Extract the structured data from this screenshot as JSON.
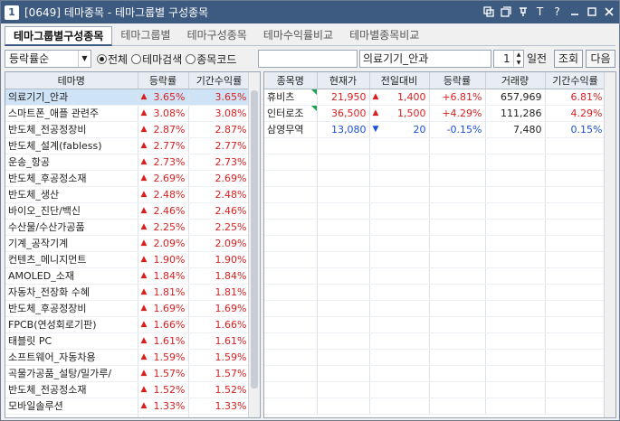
{
  "window": {
    "code": "[0649]",
    "title": "테마종목 - 테마그룹별 구성종목",
    "icon_num": "1"
  },
  "tabs": [
    "테마그룹별구성종목",
    "테마그룹별",
    "테마구성종목",
    "테마수익률비교",
    "테마별종목비교"
  ],
  "toolbar": {
    "sort_select": "등락률순",
    "radios": [
      {
        "label": "전체",
        "checked": true
      },
      {
        "label": "테마검색",
        "checked": false
      },
      {
        "label": "종목코드",
        "checked": false
      }
    ],
    "theme_input": "의료기기_안과",
    "days": "1",
    "days_label": "일전",
    "query_btn": "조회",
    "next_btn": "다음"
  },
  "left_table": {
    "headers": [
      "테마명",
      "등락률",
      "기간수익률"
    ],
    "rows": [
      {
        "name": "의료기기_안과",
        "rate": "3.65%",
        "period": "3.65%"
      },
      {
        "name": "스마트폰_애플 관련주",
        "rate": "3.08%",
        "period": "3.08%"
      },
      {
        "name": "반도체_전공정장비",
        "rate": "2.87%",
        "period": "2.87%"
      },
      {
        "name": "반도체_설계(fabless)",
        "rate": "2.77%",
        "period": "2.77%"
      },
      {
        "name": "운송_항공",
        "rate": "2.73%",
        "period": "2.73%"
      },
      {
        "name": "반도체_후공정소재",
        "rate": "2.69%",
        "period": "2.69%"
      },
      {
        "name": "반도체_생산",
        "rate": "2.48%",
        "period": "2.48%"
      },
      {
        "name": "바이오_진단/백신",
        "rate": "2.46%",
        "period": "2.46%"
      },
      {
        "name": "수산물/수산가공품",
        "rate": "2.25%",
        "period": "2.25%"
      },
      {
        "name": "기계_공작기계",
        "rate": "2.09%",
        "period": "2.09%"
      },
      {
        "name": "컨텐츠_메니지먼트",
        "rate": "1.90%",
        "period": "1.90%"
      },
      {
        "name": "AMOLED_소재",
        "rate": "1.84%",
        "period": "1.84%"
      },
      {
        "name": "자동차_전장화 수혜",
        "rate": "1.81%",
        "period": "1.81%"
      },
      {
        "name": "반도체_후공정장비",
        "rate": "1.69%",
        "period": "1.69%"
      },
      {
        "name": "FPCB(연성회로기판)",
        "rate": "1.66%",
        "period": "1.66%"
      },
      {
        "name": "태블릿 PC",
        "rate": "1.61%",
        "period": "1.61%"
      },
      {
        "name": "소프트웨어_자동차용",
        "rate": "1.59%",
        "period": "1.59%"
      },
      {
        "name": "곡물가공품_설탕/밀가루/",
        "rate": "1.57%",
        "period": "1.57%"
      },
      {
        "name": "반도체_전공정소재",
        "rate": "1.52%",
        "period": "1.52%"
      },
      {
        "name": "모바일솔루션",
        "rate": "1.33%",
        "period": "1.33%"
      }
    ]
  },
  "right_table": {
    "headers": [
      "종목명",
      "현재가",
      "전일대비",
      "등락률",
      "거래량",
      "기간수익률"
    ],
    "rows": [
      {
        "name": "휴비츠",
        "price": "21,950",
        "dir": "up",
        "change": "1,400",
        "rate": "+6.81%",
        "volume": "657,969",
        "period": "6.81%"
      },
      {
        "name": "인터로조",
        "price": "36,500",
        "dir": "up",
        "change": "1,500",
        "rate": "+4.29%",
        "volume": "111,286",
        "period": "4.29%"
      },
      {
        "name": "삼영무역",
        "price": "13,080",
        "dir": "down",
        "change": "20",
        "rate": "-0.15%",
        "volume": "7,480",
        "period": "0.15%"
      }
    ]
  },
  "colors": {
    "up": "#d92020",
    "down": "#1b4fd6",
    "titlebar": "#3d5a80",
    "selected_row": "#cfe3f6"
  }
}
